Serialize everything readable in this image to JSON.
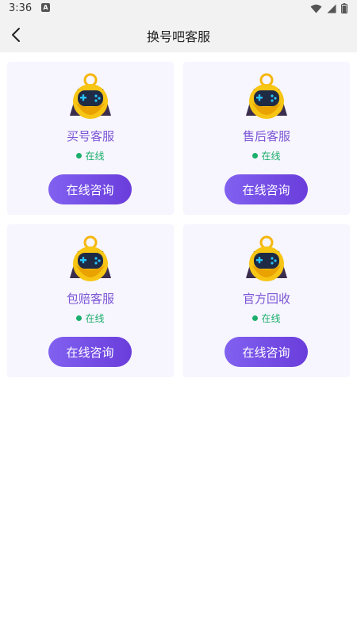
{
  "status_bar": {
    "time": "3:36",
    "app_badge": "A"
  },
  "header": {
    "title": "换号吧客服",
    "back_icon": "chevron-left-icon"
  },
  "colors": {
    "accent": "#7b56d6",
    "button_start": "#8161f0",
    "button_end": "#6a3ddb",
    "online": "#1aaf6c",
    "card_bg": "#f7f5fd"
  },
  "cards": [
    {
      "name": "买号客服",
      "status": "在线",
      "button": "在线咨询",
      "icon": "robot-gamepad-icon"
    },
    {
      "name": "售后客服",
      "status": "在线",
      "button": "在线咨询",
      "icon": "robot-gamepad-icon"
    },
    {
      "name": "包赔客服",
      "status": "在线",
      "button": "在线咨询",
      "icon": "robot-gamepad-icon"
    },
    {
      "name": "官方回收",
      "status": "在线",
      "button": "在线咨询",
      "icon": "robot-gamepad-icon"
    }
  ]
}
